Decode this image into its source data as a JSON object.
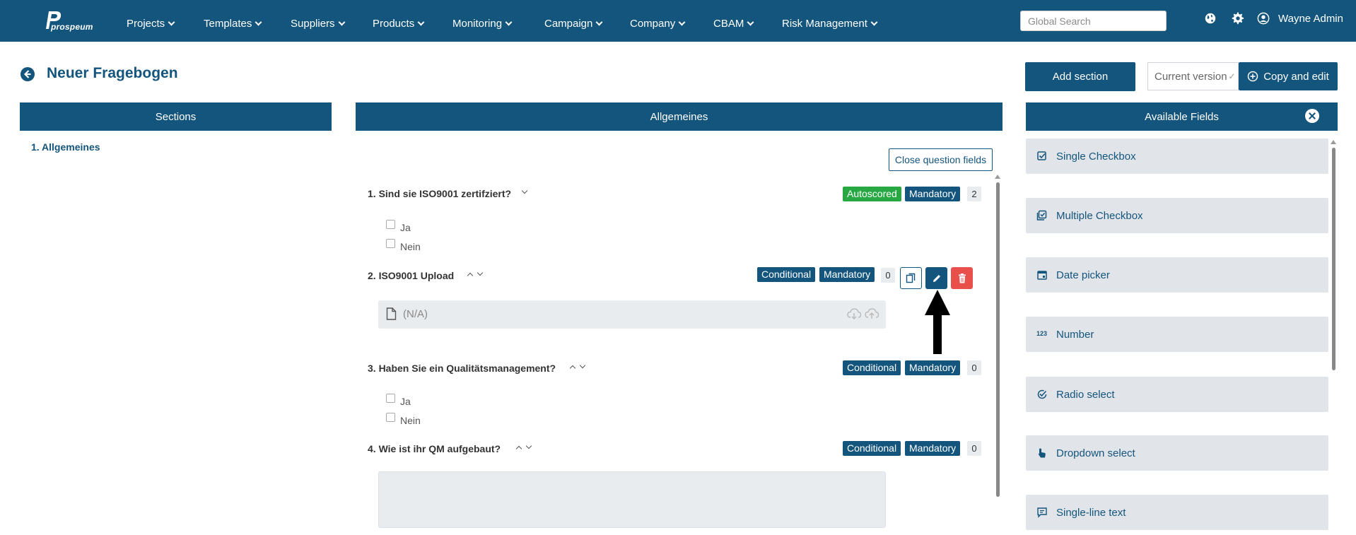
{
  "navbar": {
    "logo_text": "prospeum",
    "items": [
      {
        "label": "Projects"
      },
      {
        "label": "Templates"
      },
      {
        "label": "Suppliers"
      },
      {
        "label": "Products"
      },
      {
        "label": "Monitoring"
      },
      {
        "label": "Campaign"
      },
      {
        "label": "Company"
      },
      {
        "label": "CBAM"
      },
      {
        "label": "Risk Management"
      }
    ],
    "search_placeholder": "Global Search",
    "user_name": "Wayne Admin"
  },
  "header": {
    "title": "Neuer Fragebogen",
    "add_section": "Add section",
    "version": "Current version",
    "copy_edit": "Copy and edit"
  },
  "sections_panel": {
    "title": "Sections",
    "items": [
      {
        "label": "1. Allgemeines"
      }
    ]
  },
  "main": {
    "title": "Allgemeines",
    "close_fields": "Close question fields",
    "questions": [
      {
        "title": "1. Sind sie ISO9001 zertifziert?",
        "badges": [
          "Autoscored",
          "Mandatory"
        ],
        "count": "2",
        "options": [
          "Ja",
          "Nein"
        ]
      },
      {
        "title": "2. ISO9001 Upload",
        "badges": [
          "Conditional",
          "Mandatory"
        ],
        "count": "0",
        "upload_value": "(N/A)"
      },
      {
        "title": "3. Haben Sie ein Qualitätsmanagement?",
        "badges": [
          "Conditional",
          "Mandatory"
        ],
        "count": "0",
        "options": [
          "Ja",
          "Nein"
        ]
      },
      {
        "title": "4. Wie ist ihr QM aufgebaut?",
        "badges": [
          "Conditional",
          "Mandatory"
        ],
        "count": "0"
      }
    ]
  },
  "fields_panel": {
    "title": "Available Fields",
    "items": [
      {
        "label": "Single Checkbox",
        "icon": "checkbox-icon"
      },
      {
        "label": "Multiple Checkbox",
        "icon": "multi-checkbox-icon"
      },
      {
        "label": "Date picker",
        "icon": "calendar-icon"
      },
      {
        "label": "Number",
        "icon": "number-icon",
        "glyph": "123"
      },
      {
        "label": "Radio select",
        "icon": "radio-icon"
      },
      {
        "label": "Dropdown select",
        "icon": "pointer-icon"
      },
      {
        "label": "Single-line text",
        "icon": "text-line-icon"
      }
    ]
  },
  "colors": {
    "primary": "#14557d",
    "green": "#27a843",
    "danger": "#e9504b",
    "card_bg": "#e1e4e8"
  }
}
